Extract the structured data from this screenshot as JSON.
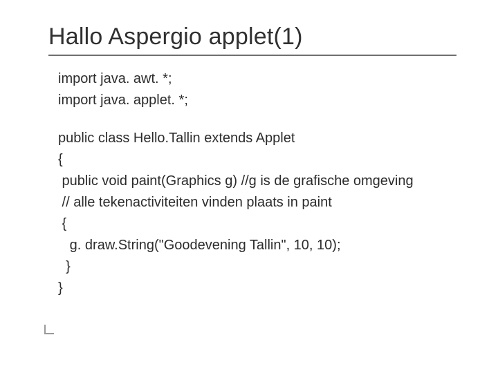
{
  "title": "Hallo Aspergio applet(1)",
  "code": {
    "l1": "import java. awt. *;",
    "l2": "import java. applet. *;",
    "l3": "public class Hello.Tallin extends Applet",
    "l4": "{",
    "l5": " public void paint(Graphics g) //g is de grafische omgeving",
    "l6": " // alle tekenactiviteiten vinden plaats in paint",
    "l7": " {",
    "l8": "   g. draw.String(\"Goodevening Tallin\", 10, 10);",
    "l9": "  }",
    "l10": "}"
  }
}
